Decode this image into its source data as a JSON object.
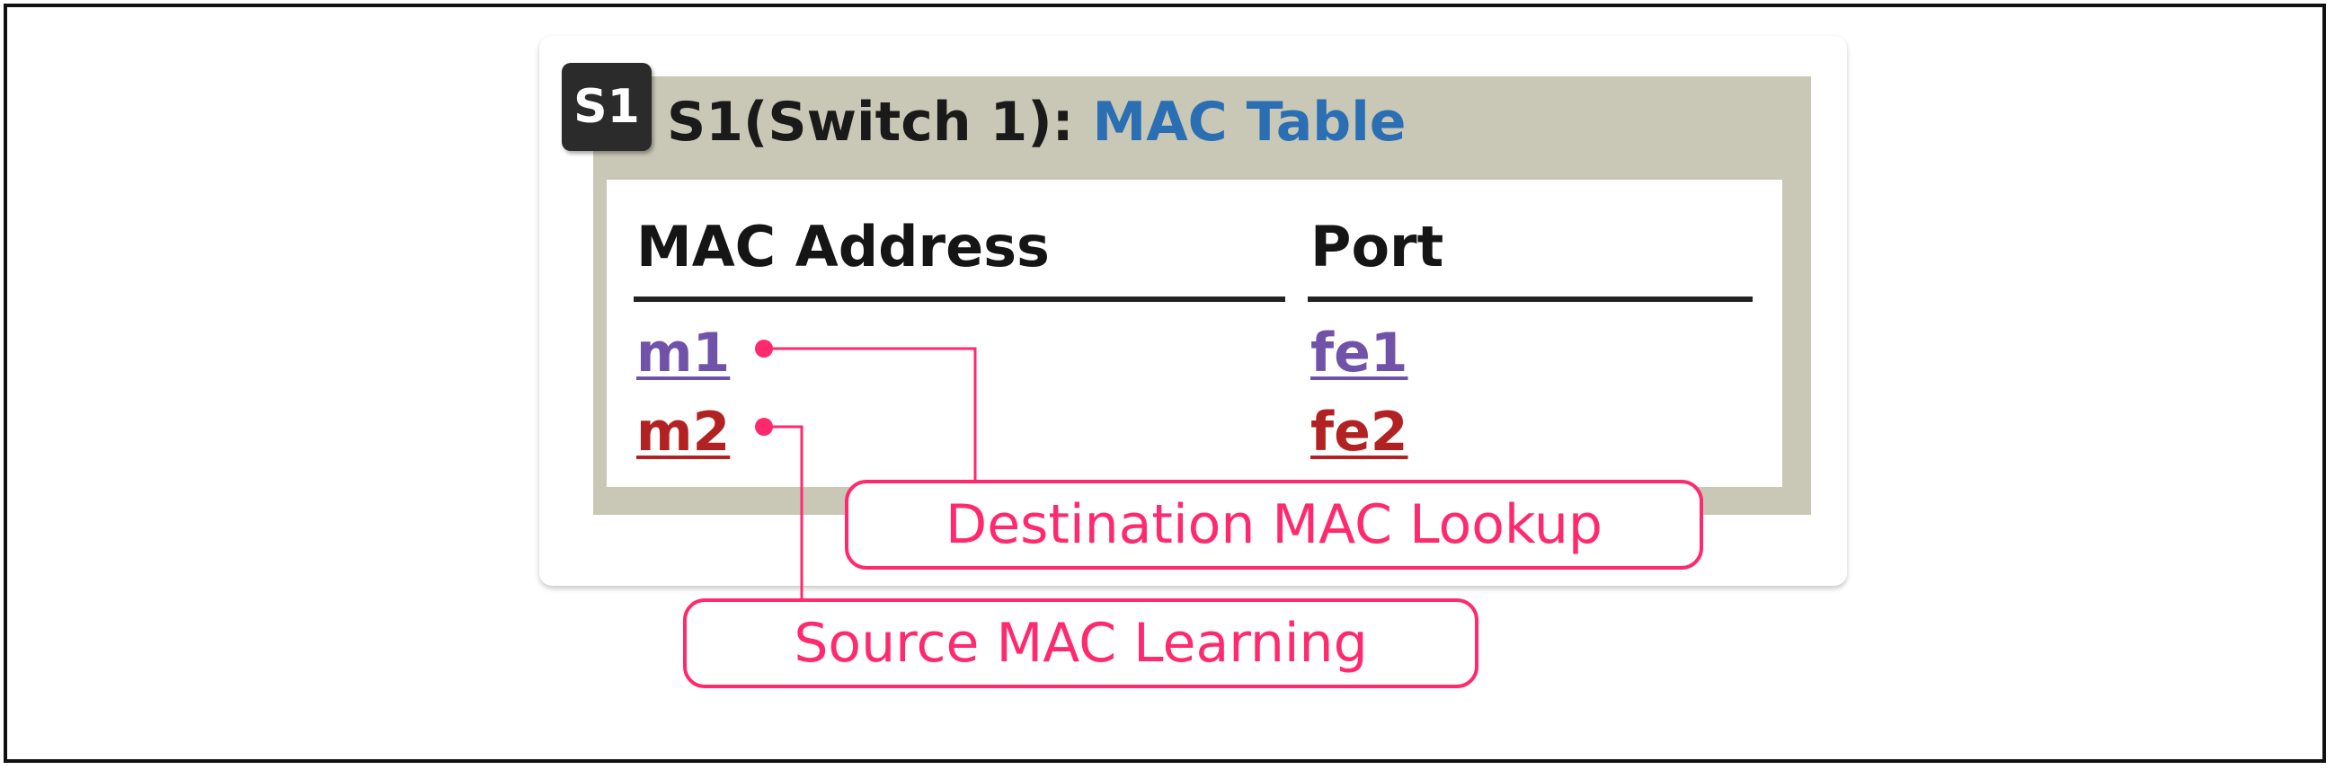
{
  "panel": {
    "badge": "S1",
    "title_prefix": "S1(Switch 1): ",
    "title_accent": "MAC Table"
  },
  "table": {
    "headers": [
      "MAC Address",
      "Port"
    ],
    "rows": [
      {
        "mac": "m1",
        "port": "fe1"
      },
      {
        "mac": "m2",
        "port": "fe2"
      }
    ]
  },
  "callouts": {
    "destination": "Destination MAC Lookup",
    "source": "Source MAC Learning"
  },
  "colors": {
    "band": "#c9c7b5",
    "title_accent": "#2a6eb3",
    "row1": "#7052a8",
    "row2": "#b22222",
    "callout": "#ff2a6d"
  }
}
